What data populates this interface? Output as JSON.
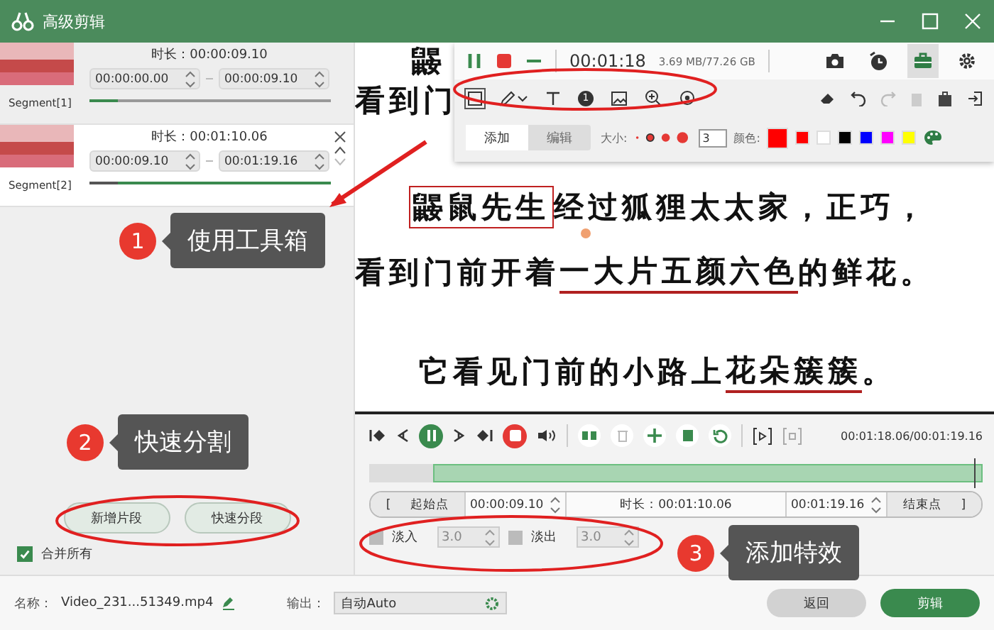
{
  "window": {
    "title": "高级剪辑"
  },
  "segments": [
    {
      "label": "Segment[1]",
      "duration": "时长：00:00:09.10",
      "start": "00:00:00.00",
      "end": "00:00:09.10",
      "selected": false,
      "level": 0.12
    },
    {
      "label": "Segment[2]",
      "duration": "时长：00:01:10.06",
      "start": "00:00:09.10",
      "end": "00:01:19.16",
      "selected": true,
      "level": 0.88
    }
  ],
  "segment_buttons": [
    "新增片段",
    "快速分段"
  ],
  "merge_all": {
    "label": "合并所有",
    "checked": true
  },
  "preview": {
    "lines": [
      {
        "parts": [
          {
            "kind": "plain",
            "text": "鼹"
          }
        ]
      },
      {
        "parts": [
          {
            "kind": "plain",
            "text": "看到门"
          }
        ]
      },
      {
        "parts": [
          {
            "kind": "boxed",
            "text": "鼹鼠先生"
          },
          {
            "kind": "plain",
            "text": "经过狐狸太太家，正巧，"
          }
        ]
      },
      {
        "parts": [
          {
            "kind": "plain",
            "text": "看到门前开着"
          },
          {
            "kind": "underlined",
            "text": "一大片五颜六色"
          },
          {
            "kind": "plain",
            "text": "的鲜花。"
          }
        ]
      },
      {
        "parts": [
          {
            "kind": "plain",
            "text": "它看见门前的小路上"
          },
          {
            "kind": "underlined",
            "text": "花朵簇簇"
          },
          {
            "kind": "plain",
            "text": "。"
          }
        ]
      }
    ]
  },
  "recorder": {
    "time": "00:01:18",
    "storage": "3.69 MB/77.26 GB",
    "top_tools": [
      {
        "kind": "camera",
        "selected": false
      },
      {
        "kind": "timer",
        "selected": false
      },
      {
        "kind": "toolbox",
        "selected": true
      },
      {
        "kind": "settings",
        "selected": false
      }
    ],
    "draw_tools": [
      {
        "kind": "rect",
        "selected": true
      },
      {
        "kind": "pen",
        "selected": false
      },
      {
        "kind": "text",
        "selected": false
      },
      {
        "kind": "number",
        "label": "1",
        "selected": false
      },
      {
        "kind": "image",
        "selected": false
      },
      {
        "kind": "zoom",
        "selected": false
      },
      {
        "kind": "spotlight",
        "selected": false
      }
    ],
    "mode_tabs": [
      {
        "label": "添加",
        "selected": true
      },
      {
        "label": "编辑",
        "selected": false
      }
    ],
    "size_label": "大小:",
    "size_value": "3",
    "color_label": "颜色:",
    "colors": [
      {
        "color": "#ff0000",
        "selected": true
      },
      {
        "color": "#ff0000",
        "selected": false
      },
      {
        "color": "#ffffff",
        "selected": false
      },
      {
        "color": "#000000",
        "selected": false
      },
      {
        "color": "#0000ff",
        "selected": false
      },
      {
        "color": "#ff00ff",
        "selected": false
      },
      {
        "color": "#ffff00",
        "selected": false
      }
    ]
  },
  "player": {
    "time": "00:01:18.06/00:01:19.16",
    "level": 0.985
  },
  "range": {
    "open": "[",
    "start_label": "起始点",
    "start": "00:00:09.10",
    "duration": "时长：00:01:10.06",
    "end": "00:01:19.16",
    "end_label": "结束点",
    "close": "]"
  },
  "fades": [
    {
      "label": "淡入",
      "checked": false,
      "value": "3.0"
    },
    {
      "label": "淡出",
      "checked": false,
      "value": "3.0"
    }
  ],
  "footer": {
    "name_label": "名称：",
    "name": "Video_231...51349.mp4",
    "output_label": "输出：",
    "output": "自动Auto",
    "buttons": [
      {
        "label": "返回",
        "kind": "secondary"
      },
      {
        "label": "剪辑",
        "kind": "primary"
      }
    ]
  },
  "callouts": [
    {
      "number": "1",
      "text": "使用工具箱"
    },
    {
      "number": "2",
      "text": "快速分割"
    },
    {
      "number": "3",
      "text": "添加特效"
    }
  ]
}
